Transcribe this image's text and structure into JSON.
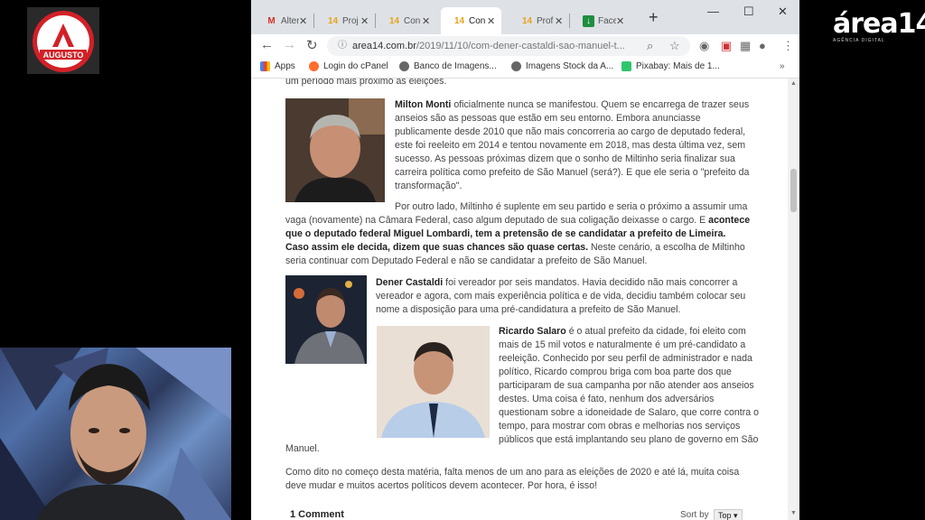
{
  "overlay": {
    "augusto_logo": "AUGUSTO",
    "area14_logo": "área14",
    "area14_tagline": "AGÊNCIA DIGITAL"
  },
  "browser": {
    "tabs": [
      {
        "label": "Alter",
        "favicon": "M"
      },
      {
        "label": "Proj",
        "favicon": "14"
      },
      {
        "label": "Con",
        "favicon": "14"
      },
      {
        "label": "Con",
        "favicon": "14"
      },
      {
        "label": "Prof",
        "favicon": "14"
      },
      {
        "label": "Face",
        "favicon": "↓"
      }
    ],
    "url_domain": "area14.com.br",
    "url_path": "/2019/11/10/com-dener-castaldi-sao-manuel-t...",
    "bookmarks": [
      "Apps",
      "Login do cPanel",
      "Banco de Imagens...",
      "Imagens Stock da A...",
      "Pixabay: Mais de 1..."
    ]
  },
  "article": {
    "top_partial": "um período mais próximo as eleições.",
    "milton_name": "Milton Monti",
    "milton_l1_rest": " oficialmente nunca se manifestou. Quem se encarrega de trazer seus",
    "milton_l2": "anseios são as pessoas que estão em seu entorno. Embora anunciasse",
    "milton_l3": "publicamente desde 2010 que não mais concorreria ao cargo de deputado federal,",
    "milton_l4": "este foi reeleito em 2014 e tentou novamente em 2018, mas desta última vez, sem",
    "milton_l5": "sucesso. As pessoas próximas dizem que o sonho de Miltinho seria finalizar sua",
    "milton_l6": "carreira política como prefeito de São Manuel (será?). E que ele seria o \"prefeito da",
    "milton_l7": "transformação\".",
    "p2_l1": "Por outro lado, Miltinho é suplente em seu partido e seria o próximo a assumir uma",
    "p2_l2_normal": "vaga (novamente) na Câmara Federal, caso algum deputado de sua coligação deixasse o cargo. E ",
    "p2_l2_bold": "acontece",
    "p2_l3_bold": "que o deputado federal Miguel Lombardi, tem a pretensão de se candidatar a prefeito de Limeira.",
    "p2_l4_bold": "Caso assim ele decida, dizem que suas chances são quase certas.",
    "p2_l4_normal": " Neste cenário, a escolha de Miltinho",
    "p2_l5": "seria continuar com Deputado Federal e não se candidatar a prefeito de São Manuel.",
    "dener_name": "Dener Castaldi",
    "dener_l1_rest": " foi vereador por seis mandatos. Havia decidido não mais concorrer a",
    "dener_l2": "vereador e agora, com mais experiência política e de vida, decidiu também colocar seu",
    "dener_l3": "nome a disposição para uma pré-candidatura a prefeito de São Manuel.",
    "ricardo_name": "Ricardo Salaro",
    "ricardo_l1_rest": " é o atual prefeito da cidade, foi eleito com",
    "ricardo_l2": "mais de 15 mil votos e naturalmente é um pré-candidato a",
    "ricardo_l3": "reeleição. Conhecido por seu perfil de administrador e nada",
    "ricardo_l4": "político, Ricardo comprou briga com boa parte dos que",
    "ricardo_l5": "participaram de sua campanha por não atender aos anseios",
    "ricardo_l6": "destes. Uma coisa é fato, nenhum dos adversários",
    "ricardo_l7": "questionam sobre a idoneidade de Salaro, que corre contra o",
    "ricardo_l8": "tempo, para mostrar com obras e melhorias nos serviços",
    "ricardo_l9": "públicos que está implantando seu plano de governo em São",
    "ricardo_l10": "Manuel.",
    "final_l1": "Como dito no começo desta matéria, falta menos de um ano para as eleições de 2020 e até lá, muita coisa",
    "final_l2": "deve mudar e muitos acertos políticos devem acontecer. Por hora, é isso!",
    "comments_count": "1 Comment",
    "sort_label": "Sort by",
    "sort_value": "Top"
  }
}
